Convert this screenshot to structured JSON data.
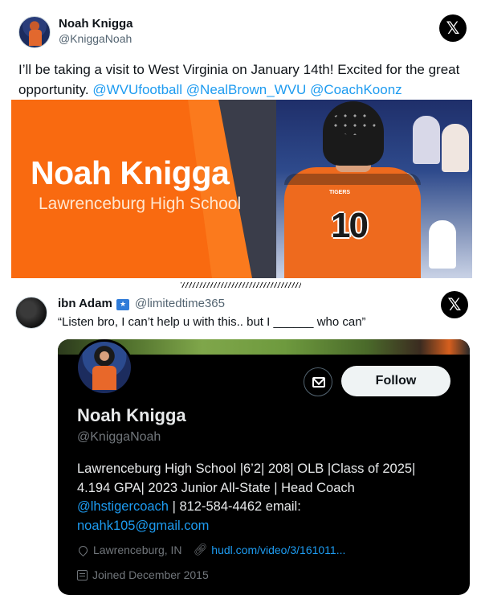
{
  "tweet1": {
    "author_name": "Noah Knigga",
    "author_handle": "@KniggaNoah",
    "text_prefix": "I’ll be taking a visit to West Virginia on January 14th! Excited for the great opportunity.",
    "mentions": [
      "@WVUfootball",
      "@NealBrown_WVU",
      "@CoachKoonz"
    ],
    "banner": {
      "name": "Noah Knigga",
      "school": "Lawrenceburg High School",
      "jersey_number": "10",
      "jersey_text": "TIGERS"
    }
  },
  "tweet2": {
    "author_name": "ibn Adam",
    "badge_icon": "flag-badge-icon",
    "author_handle": "@limitedtime365",
    "text": "“Listen bro, I can’t help u with this.. but I ______ who can”"
  },
  "profile_card": {
    "name": "Noah Knigga",
    "handle": "@KniggaNoah",
    "follow_label": "Follow",
    "bio_line1": "Lawrenceburg High School |6’2| 208| OLB |Class of 2025|",
    "bio_line2": "4.194 GPA| 2023 Junior All-State | Head Coach",
    "bio_link": "@lhstigercoach",
    "bio_line3_rest": " | 812-584-4462 email:",
    "bio_email": "noahk105@gmail.com",
    "location": "Lawrenceburg, IN",
    "website": "hudl.com/video/3/161011...",
    "joined": "Joined December 2015"
  },
  "icons": {
    "x_logo": "x-logo-icon",
    "message": "envelope-icon",
    "location": "map-pin-icon",
    "link": "link-icon",
    "calendar": "calendar-icon"
  },
  "colors": {
    "link_blue": "#1d9bf0",
    "banner_orange": "#fb7a1d",
    "card_bg": "#000000"
  }
}
